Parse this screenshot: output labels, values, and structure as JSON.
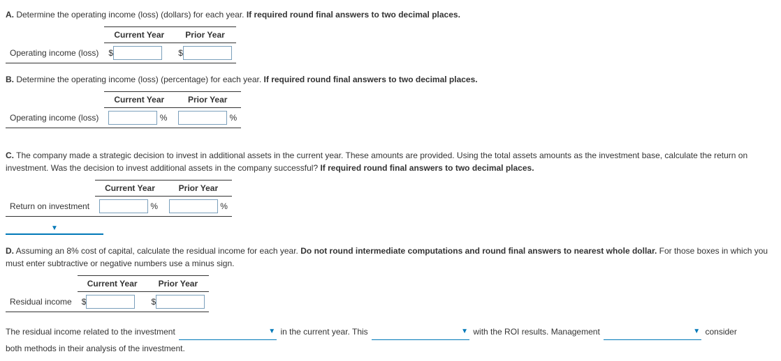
{
  "sectionA": {
    "label": "A.",
    "prompt_plain": "Determine the operating income (loss) (dollars) for each year.",
    "prompt_bold": "If required round final answers to two decimal places.",
    "col_current": "Current Year",
    "col_prior": "Prior Year",
    "row_label": "Operating income (loss)",
    "currency": "$"
  },
  "sectionB": {
    "label": "B.",
    "prompt_plain": "Determine the operating income (loss) (percentage) for each year.",
    "prompt_bold": "If required round final answers to two decimal places.",
    "col_current": "Current Year",
    "col_prior": "Prior Year",
    "row_label": "Operating income (loss)",
    "unit": "%"
  },
  "sectionC": {
    "label": "C.",
    "prompt_plain": "The company made a strategic decision to invest in additional assets in the current year. These amounts are provided. Using the total assets amounts as the investment base, calculate the return on investment. Was the decision to invest additional assets in the company successful?",
    "prompt_bold": "If required round final answers to two decimal places.",
    "col_current": "Current Year",
    "col_prior": "Prior Year",
    "row_label": "Return on investment",
    "unit": "%"
  },
  "sectionD": {
    "label": "D.",
    "prompt_plain": "Assuming an 8% cost of capital, calculate the residual income for each year.",
    "prompt_bold": "Do not round intermediate computations and round final answers to nearest whole dollar.",
    "prompt_after": "For those boxes in which you must enter subtractive or negative numbers use a minus sign.",
    "col_current": "Current Year",
    "col_prior": "Prior Year",
    "row_label": "Residual income",
    "currency": "$",
    "closing": {
      "part1": "The residual income related to the investment",
      "part2": "in the current year. This",
      "part3": "with the ROI results. Management",
      "part4": "consider",
      "part5": "both methods in their analysis of the investment."
    }
  }
}
